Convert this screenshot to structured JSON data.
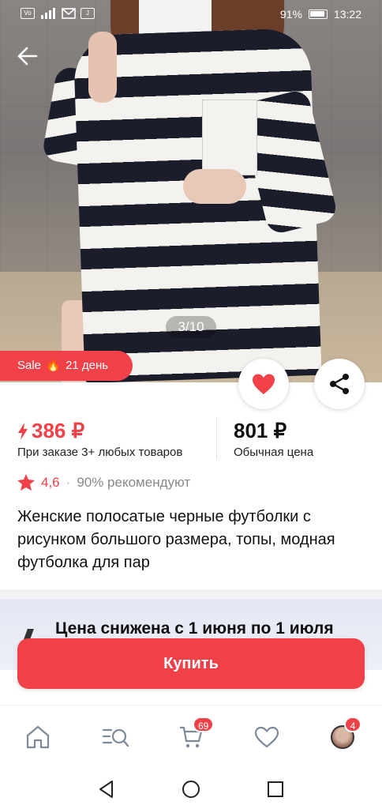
{
  "status_bar": {
    "left_icons": [
      "VoLTE",
      "4G",
      "signal",
      "mail",
      "J"
    ],
    "battery_percent": "91%",
    "time": "13:22"
  },
  "hero": {
    "image_desc_icon": "product-photo",
    "page_indicator": "3/10",
    "sale_badge": {
      "prefix": "Sale",
      "suffix": "21 день"
    }
  },
  "price": {
    "sale_price": "386 ₽",
    "sale_note": "При заказе 3+ любых товаров",
    "regular_price": "801 ₽",
    "regular_note": "Обычная цена"
  },
  "rating": {
    "value": "4,6",
    "separator": "·",
    "recommend": "90% рекомендуют"
  },
  "product": {
    "title": "Женские полосатые черные футболки с рисунком большого размера, топы, модная футболка для пар"
  },
  "promo": {
    "text": "Цена снижена с 1 июня по 1 июля"
  },
  "buy_button": {
    "label": "Купить"
  },
  "tabbar": {
    "cart_badge": "69",
    "profile_badge": "4"
  },
  "colors": {
    "accent": "#f04148",
    "promo_bg": "#e3e7f3"
  }
}
